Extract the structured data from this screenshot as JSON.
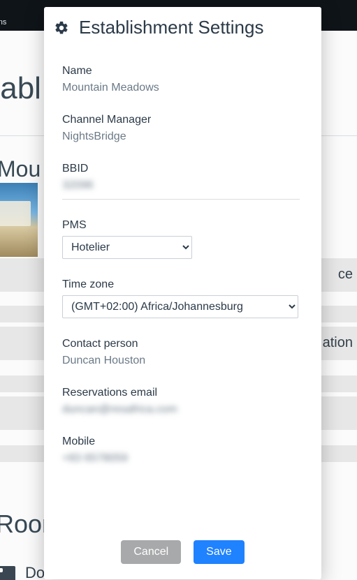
{
  "background": {
    "nav_item_1": "ations",
    "heading_fragment": "tabl",
    "subheading_fragment": "Mou",
    "rooms_heading_fragment": "Room",
    "row_texts": {
      "r1": "ce",
      "r2": "ation",
      "r3": ""
    },
    "room_item_fragment": "Do"
  },
  "modal": {
    "title": "Establishment Settings",
    "fields": {
      "name": {
        "label": "Name",
        "value": "Mountain Meadows"
      },
      "channel_manager": {
        "label": "Channel Manager",
        "value": "NightsBridge"
      },
      "bbid": {
        "label": "BBID",
        "value": "32096"
      },
      "pms": {
        "label": "PMS",
        "selected": "Hotelier"
      },
      "timezone": {
        "label": "Time zone",
        "selected": "(GMT+02:00) Africa/Johannesburg"
      },
      "contact_person": {
        "label": "Contact person",
        "value": "Duncan Houston"
      },
      "reservations_email": {
        "label": "Reservations email",
        "value": "duncan@resafrica.com"
      },
      "mobile": {
        "label": "Mobile",
        "value": "+83 6578059"
      }
    },
    "buttons": {
      "cancel": "Cancel",
      "save": "Save"
    }
  }
}
